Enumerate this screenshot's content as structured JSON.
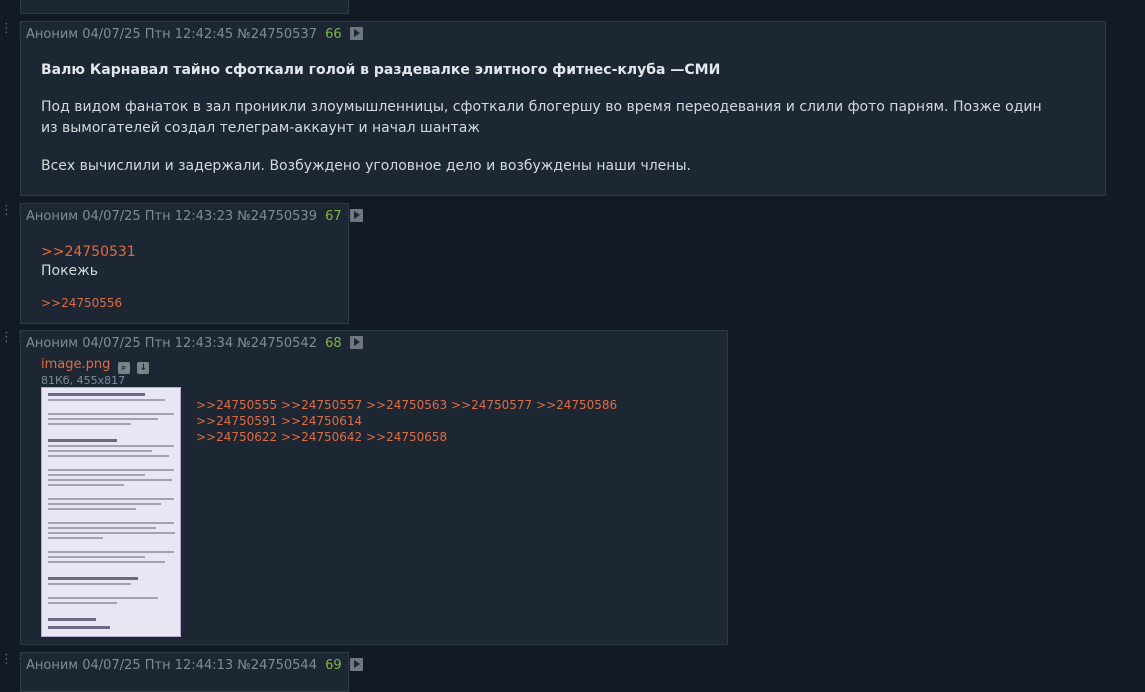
{
  "posts": [
    {
      "author": "Аноним",
      "datetime": "04/07/25 Птн 12:42:45",
      "number": "№24750537",
      "count": "66",
      "subject": "Валю Карнавал тайно сфоткали голой в раздевалке элитного фитнес-клуба —СМИ",
      "paragraphs": [
        "Под видом фанаток в зал проникли злоумышленницы, сфоткали блогершу во время переодевания и слили фото парням. Позже один из вымогателей создал телеграм-аккаунт и начал шантаж",
        "Всех вычислили и задержали. Возбуждено уголовное дело и возбуждены наши члены."
      ]
    },
    {
      "author": "Аноним",
      "datetime": "04/07/25 Птн 12:43:23",
      "number": "№24750539",
      "count": "67",
      "reply_to": ">>24750531",
      "body": "Покежь",
      "backlinks": ">>24750556"
    },
    {
      "author": "Аноним",
      "datetime": "04/07/25 Птн 12:43:34",
      "number": "№24750542",
      "count": "68",
      "file_name": "image.png",
      "file_info": "81Кб, 455x817",
      "backlinks_line1": ">>24750555 >>24750557 >>24750563 >>24750577 >>24750586 >>24750591 >>24750614",
      "backlinks_line2": ">>24750622 >>24750642 >>24750658"
    },
    {
      "author": "Аноним",
      "datetime": "04/07/25 Птн 12:44:13",
      "number": "№24750544",
      "count": "69"
    }
  ],
  "icons": {
    "more": "more-dots-icon",
    "play": "play-icon",
    "search": "search-icon",
    "download": "download-icon"
  },
  "colors": {
    "background": "#121b24",
    "post_bg": "#1c2733",
    "reply_link": "#e06b3f",
    "post_count": "#80b53f"
  }
}
